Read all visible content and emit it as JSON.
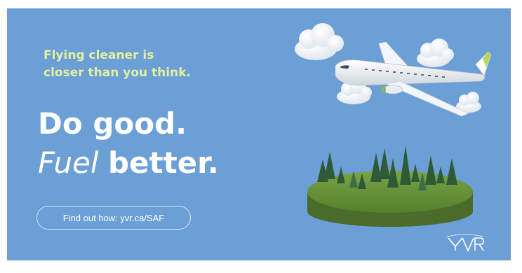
{
  "ad": {
    "tagline_line1": "Flying cleaner is",
    "tagline_line2": "closer than you think.",
    "headline_line1": "Do good.",
    "headline_fuel": "Fuel",
    "headline_better": "better.",
    "cta_label": "Find out how: yvr.ca/SAF",
    "logo_text": "YVR"
  },
  "icons": [
    "cloud-icon",
    "airplane-icon",
    "forest-island-icon",
    "yvr-logo-icon"
  ],
  "colors": {
    "background": "#6b9fd6",
    "tagline": "#e3f0a0",
    "headline": "#ffffff",
    "grass": "#5e8a34"
  }
}
